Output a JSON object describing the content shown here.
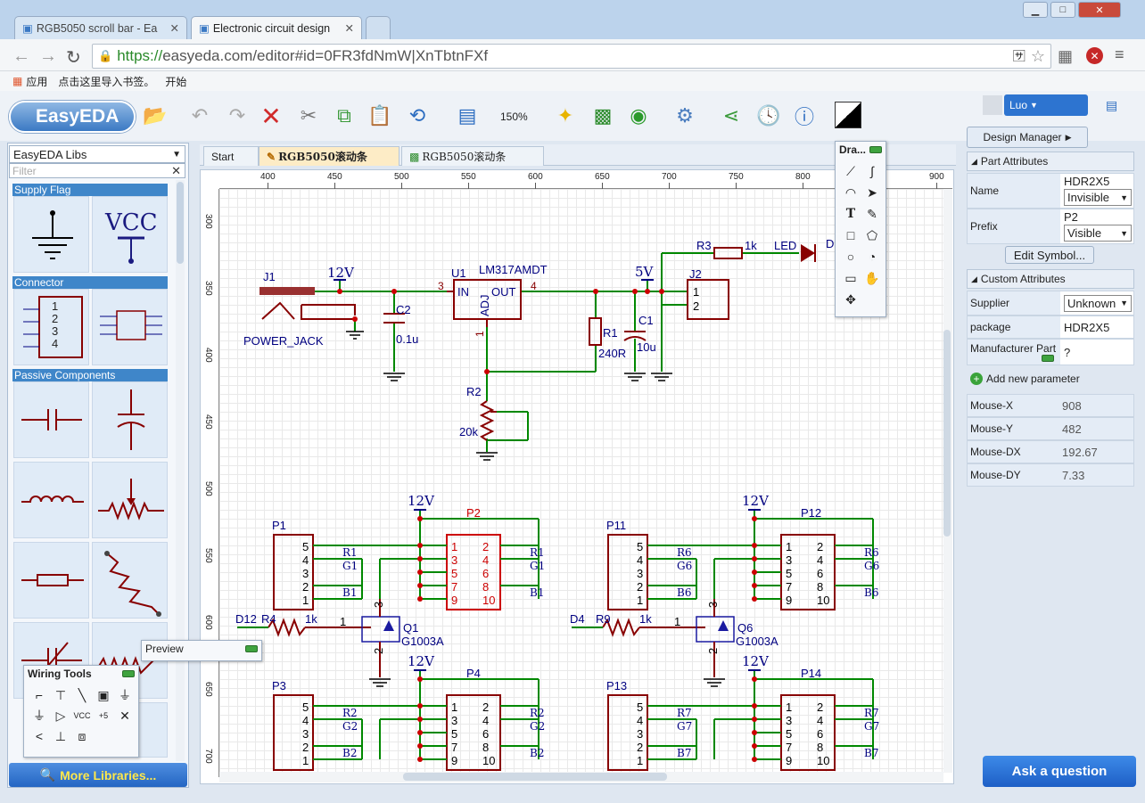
{
  "browser": {
    "tabs": [
      {
        "label": "RGB5050 scroll bar - Ea"
      },
      {
        "label": "Electronic circuit design"
      }
    ],
    "url_scheme": "https://",
    "url_rest": "easyeda.com/editor#id=0FR3fdNmW|XnTbtnFXf",
    "bookmarks": {
      "apps": "应用",
      "import": "点击这里导入书签。",
      "start": "开始"
    }
  },
  "toolbar": {
    "logo": "EasyEDA",
    "zoom": "150%",
    "user": "Luo"
  },
  "library": {
    "selected": "EasyEDA Libs",
    "filter_placeholder": "Filter",
    "sections": [
      "Supply Flag",
      "Connector",
      "Passive Components"
    ],
    "vcc_label": "VCC",
    "connector_pins": [
      "1",
      "2",
      "3",
      "4"
    ],
    "more": "More Libraries..."
  },
  "doc_tabs": [
    "Start",
    "RGB5050滚动条",
    "RGB5050滚动条"
  ],
  "ruler": {
    "h": [
      "400",
      "450",
      "500",
      "550",
      "600",
      "650",
      "700",
      "750",
      "800",
      "850",
      "900"
    ],
    "v": [
      "300",
      "350",
      "400",
      "450",
      "500",
      "550",
      "600",
      "650",
      "700"
    ]
  },
  "schematic": {
    "j1": "J1",
    "power_jack": "POWER_JACK",
    "v12": "12V",
    "c2": "C2",
    "c2_val": "0.1u",
    "u1": "U1",
    "u1_part": "LM317AMDT",
    "in": "IN",
    "out": "OUT",
    "adj": "ADJ",
    "pin3": "3",
    "pin4": "4",
    "pin1": "1",
    "v5": "5V",
    "c1": "C1",
    "c1_val": "10u",
    "r1": "R1",
    "r1_val": "240R",
    "r2": "R2",
    "r2_val": "20k",
    "r3": "R3",
    "r3_val": "1k",
    "led": "LED",
    "d": "D",
    "j2": "J2",
    "j2_pins": [
      "1",
      "2"
    ],
    "p1": "P1",
    "p2": "P2",
    "p3": "P3",
    "p4": "P4",
    "p11": "P11",
    "p12": "P12",
    "p13": "P13",
    "p14": "P14",
    "hdr_left_pins": [
      "5",
      "4",
      "3",
      "2",
      "1"
    ],
    "hdr_odd": [
      "1",
      "3",
      "5",
      "7",
      "9"
    ],
    "hdr_even": [
      "2",
      "4",
      "6",
      "8",
      "10"
    ],
    "net_r1": "R1",
    "net_g1": "G1",
    "net_b1": "B1",
    "net_r2": "R2",
    "net_g2": "G2",
    "net_b2": "B2",
    "net_r6": "R6",
    "net_g6": "G6",
    "net_b6": "B6",
    "net_r7": "R7",
    "net_g7": "G7",
    "net_b7": "B7",
    "d12": "D12",
    "r4": "R4",
    "k1": "1k",
    "q1": "Q1",
    "q_part": "G1003A",
    "d4": "D4",
    "r9": "R9",
    "q6": "Q6",
    "q_pin1": "1",
    "q_pin3": "3",
    "q_pin2": "2"
  },
  "panels": {
    "draw": "Dra...",
    "preview": "Preview",
    "wiring": "Wiring Tools",
    "vcc_tool": "VCC",
    "plus5_tool": "+5"
  },
  "right": {
    "design_manager": "Design Manager",
    "part_attr": "Part Attributes",
    "name_k": "Name",
    "name_v": "HDR2X5",
    "name_vis": "Invisible",
    "prefix_k": "Prefix",
    "prefix_v": "P2",
    "prefix_vis": "Visible",
    "edit_symbol": "Edit Symbol...",
    "custom_attr": "Custom Attributes",
    "supplier_k": "Supplier",
    "supplier_v": "Unknown",
    "package_k": "package",
    "package_v": "HDR2X5",
    "mfr_k": "Manufacturer Part",
    "mfr_v": "?",
    "add_param": "Add new parameter",
    "mouse": [
      {
        "k": "Mouse-X",
        "v": "908"
      },
      {
        "k": "Mouse-Y",
        "v": "482"
      },
      {
        "k": "Mouse-DX",
        "v": "192.67"
      },
      {
        "k": "Mouse-DY",
        "v": "7.33"
      }
    ],
    "ask": "Ask a question"
  },
  "colors": {
    "wire": "#008800",
    "part": "#880000",
    "net": "#000080",
    "accent": "#2d74d0"
  }
}
